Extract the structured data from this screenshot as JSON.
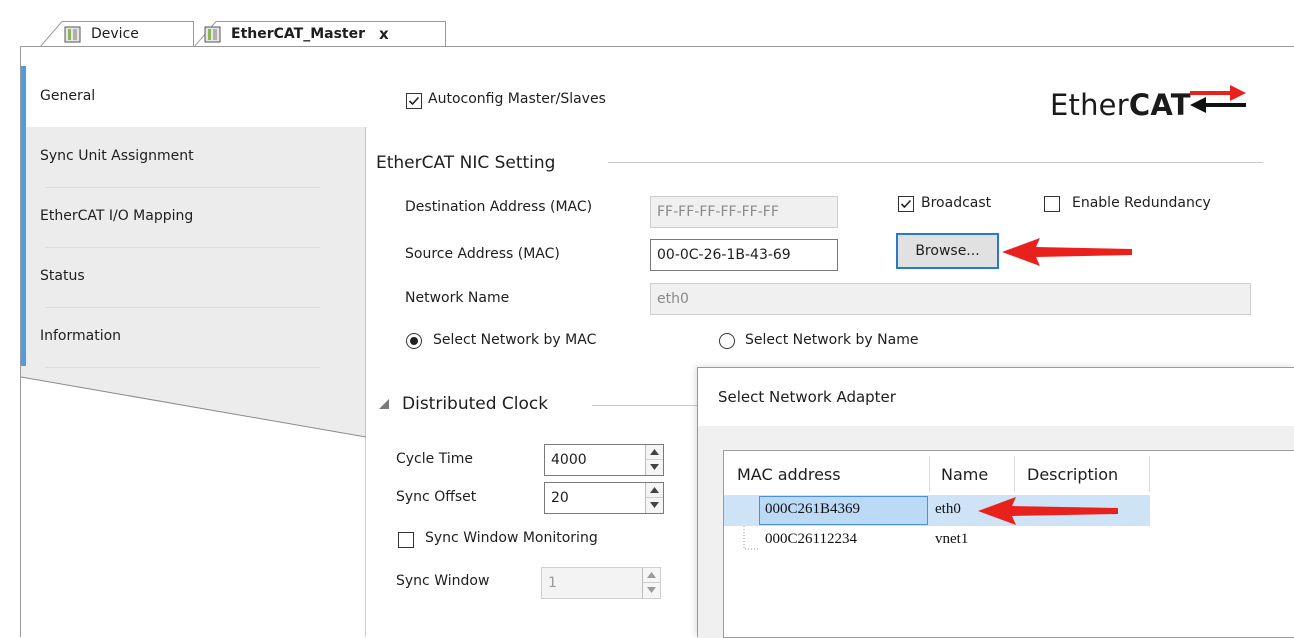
{
  "tabs": [
    {
      "label": "Device",
      "icon": "device-icon"
    },
    {
      "label": "EtherCAT_Master",
      "icon": "device-icon",
      "close": "x"
    }
  ],
  "sidebar": {
    "items": [
      {
        "label": "General",
        "active": true
      },
      {
        "label": "Sync Unit Assignment"
      },
      {
        "label": "EtherCAT I/O Mapping"
      },
      {
        "label": "Status"
      },
      {
        "label": "Information"
      }
    ]
  },
  "general": {
    "autoconfig_label": "Autoconfig Master/Slaves",
    "autoconfig_checked": true,
    "logo_text_normal": "Ether",
    "logo_text_bold": "CAT",
    "nic_section_title": "EtherCAT NIC Setting",
    "dest_label": "Destination Address (MAC)",
    "dest_value": "FF-FF-FF-FF-FF-FF",
    "broadcast_label": "Broadcast",
    "broadcast_checked": true,
    "redundancy_label": "Enable Redundancy",
    "redundancy_checked": false,
    "source_label": "Source Address (MAC)",
    "source_value": "00-0C-26-1B-43-69",
    "browse_label": "Browse...",
    "network_name_label": "Network Name",
    "network_name_value": "eth0",
    "radio_mac_label": "Select Network by MAC",
    "radio_name_label": "Select Network by Name",
    "selected_radio": "mac",
    "dc_section_title": "Distributed Clock",
    "cycle_time_label": "Cycle Time",
    "cycle_time_value": "4000",
    "sync_offset_label": "Sync Offset",
    "sync_offset_value": "20",
    "sync_window_monitoring_label": "Sync Window Monitoring",
    "sync_window_monitoring_checked": false,
    "sync_window_label": "Sync Window",
    "sync_window_value": "1"
  },
  "popup": {
    "title": "Select Network Adapter",
    "columns": [
      "MAC address",
      "Name",
      "Description"
    ],
    "rows": [
      {
        "mac": "000C261B4369",
        "name": "eth0",
        "description": "",
        "selected": true
      },
      {
        "mac": "000C26112234",
        "name": "vnet1",
        "description": "",
        "selected": false
      }
    ]
  },
  "colors": {
    "accent": "#4f9de0",
    "selection": "#cfe3f7",
    "arrow": "#e8211c"
  }
}
